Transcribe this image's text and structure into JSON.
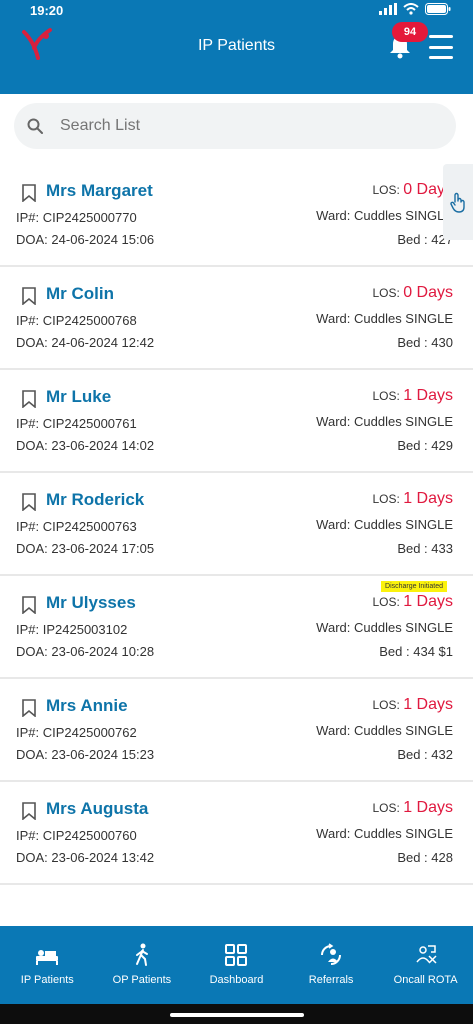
{
  "status": {
    "time": "19:20"
  },
  "header": {
    "title": "IP Patients",
    "notification_count": "94"
  },
  "search": {
    "placeholder": "Search List"
  },
  "patients": [
    {
      "name": "Mrs Margaret",
      "ip_label": "IP#:",
      "ip": "CIP2425000770",
      "doa_label": "DOA:",
      "doa": "24-06-2024 15:06",
      "los_label": "LOS:",
      "los": "0 Days",
      "ward_label": "Ward:",
      "ward": "Cuddles SINGLE",
      "bed_label": "Bed :",
      "bed": "427"
    },
    {
      "name": "Mr Colin",
      "ip_label": "IP#:",
      "ip": "CIP2425000768",
      "doa_label": "DOA:",
      "doa": "24-06-2024 12:42",
      "los_label": "LOS:",
      "los": "0 Days",
      "ward_label": "Ward:",
      "ward": "Cuddles SINGLE",
      "bed_label": "Bed :",
      "bed": "430"
    },
    {
      "name": "Mr Luke",
      "ip_label": "IP#:",
      "ip": "CIP2425000761",
      "doa_label": "DOA:",
      "doa": "23-06-2024 14:02",
      "los_label": "LOS:",
      "los": "1 Days",
      "ward_label": "Ward:",
      "ward": "Cuddles SINGLE",
      "bed_label": "Bed :",
      "bed": "429"
    },
    {
      "name": "Mr Roderick",
      "ip_label": "IP#:",
      "ip": "CIP2425000763",
      "doa_label": "DOA:",
      "doa": "23-06-2024 17:05",
      "los_label": "LOS:",
      "los": "1 Days",
      "ward_label": "Ward:",
      "ward": "Cuddles SINGLE",
      "bed_label": "Bed :",
      "bed": "433"
    },
    {
      "name": "Mr Ulysses",
      "ip_label": "IP#:",
      "ip": "IP2425003102",
      "doa_label": "DOA:",
      "doa": "23-06-2024 10:28",
      "los_label": "LOS:",
      "los": "1 Days",
      "ward_label": "Ward:",
      "ward": "Cuddles SINGLE",
      "bed_label": "Bed :",
      "bed": "434 $1",
      "status_tag": "Discharge Initiated"
    },
    {
      "name": "Mrs Annie",
      "ip_label": "IP#:",
      "ip": "CIP2425000762",
      "doa_label": "DOA:",
      "doa": "23-06-2024 15:23",
      "los_label": "LOS:",
      "los": "1 Days",
      "ward_label": "Ward:",
      "ward": "Cuddles SINGLE",
      "bed_label": "Bed :",
      "bed": "432"
    },
    {
      "name": "Mrs Augusta",
      "ip_label": "IP#:",
      "ip": "CIP2425000760",
      "doa_label": "DOA:",
      "doa": "23-06-2024 13:42",
      "los_label": "LOS:",
      "los": "1 Days",
      "ward_label": "Ward:",
      "ward": "Cuddles SINGLE",
      "bed_label": "Bed :",
      "bed": "428"
    }
  ],
  "bottom_nav": [
    {
      "label": "IP Patients",
      "icon": "bed-icon"
    },
    {
      "label": "OP Patients",
      "icon": "walking-icon"
    },
    {
      "label": "Dashboard",
      "icon": "dashboard-icon"
    },
    {
      "label": "Referrals",
      "icon": "referrals-icon"
    },
    {
      "label": "Oncall ROTA",
      "icon": "oncall-icon"
    }
  ],
  "colors": {
    "primary": "#0a78b5",
    "name": "#0e74a9",
    "los": "#e0193f",
    "badge": "#e4193a",
    "tag": "#fbf20d"
  }
}
